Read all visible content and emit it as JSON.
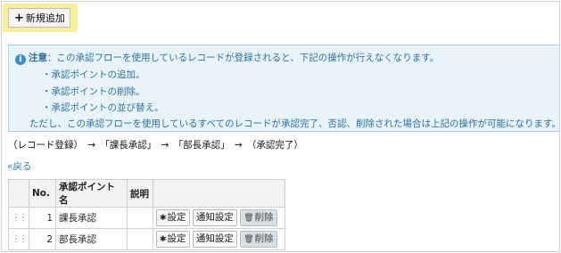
{
  "toolbar": {
    "add_label": "新規追加"
  },
  "notice": {
    "title": "注意",
    "lead": "：この承認フローを使用しているレコードが登録されると、下記の操作が行えなくなります。",
    "items": [
      "・承認ポイントの追加。",
      "・承認ポイントの削除。",
      "・承認ポイントの並び替え。"
    ],
    "footer": "ただし、この承認フローを使用しているすべてのレコードが承認完了、否認、削除された場合は上記の操作が可能になります。"
  },
  "flow": "（レコード登録）　→　「課長承認」　→　「部長承認」　→　（承認完了）",
  "back_link": "«戻る",
  "table": {
    "headers": {
      "handle": "",
      "no": "No.",
      "name": "承認ポイント名",
      "desc": "説明",
      "actions": ""
    },
    "rows": [
      {
        "no": "1",
        "name": "課長承認",
        "desc": "",
        "settings": "設定",
        "notify": "通知設定",
        "delete": "削除"
      },
      {
        "no": "2",
        "name": "部長承認",
        "desc": "",
        "settings": "設定",
        "notify": "通知設定",
        "delete": "削除"
      }
    ]
  },
  "icons": {
    "add": "plus-icon",
    "info": "info-icon",
    "settings": "gear-icon",
    "delete": "trash-icon",
    "handle": "drag-handle-icon"
  },
  "colors": {
    "highlight": "#f7ef9a",
    "notice_bg": "#e8f3fa",
    "notice_text": "#2f6f9a",
    "link": "#2f7fc1"
  }
}
